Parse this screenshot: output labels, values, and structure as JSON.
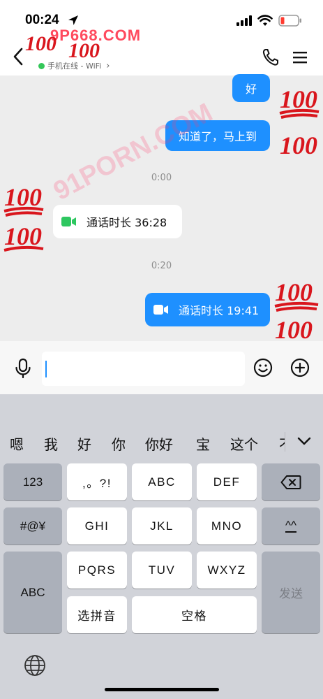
{
  "status_bar": {
    "time": "00:24"
  },
  "header": {
    "contact_name": "",
    "presence": "手机在线 - WiFi"
  },
  "messages": [
    {
      "dir": "out",
      "text": "好"
    },
    {
      "dir": "out",
      "text": "知道了，马上到"
    },
    {
      "timestamp": "0:00"
    },
    {
      "dir": "in",
      "call": true,
      "text": "通话时长 36:28"
    },
    {
      "timestamp": "0:20"
    },
    {
      "dir": "out",
      "call": true,
      "text": "通话时长 19:41"
    }
  ],
  "input": {
    "value": "",
    "placeholder": ""
  },
  "keyboard": {
    "candidates": [
      "嗯",
      "我",
      "好",
      "你",
      "你好",
      "宝",
      "这个",
      "不"
    ],
    "keys": {
      "num": "123",
      "punct": ",。?!",
      "abc_top": "ABC",
      "def": "DEF",
      "sym": "#@¥",
      "ghi": "GHI",
      "jkl": "JKL",
      "mno": "MNO",
      "face": "^^",
      "abc_side": "ABC",
      "pqrs": "PQRS",
      "tuv": "TUV",
      "wxyz": "WXYZ",
      "send": "发送",
      "pinyin": "选拼音",
      "space": "空格"
    }
  },
  "watermarks": [
    "9P668.COM",
    "91PORN.COM",
    "100"
  ],
  "colors": {
    "accent": "#1e90ff",
    "call_green": "#2ec760",
    "chat_bg": "#ededed",
    "keyboard_bg": "#d1d3d9",
    "battery_low": "#ff3b30"
  }
}
